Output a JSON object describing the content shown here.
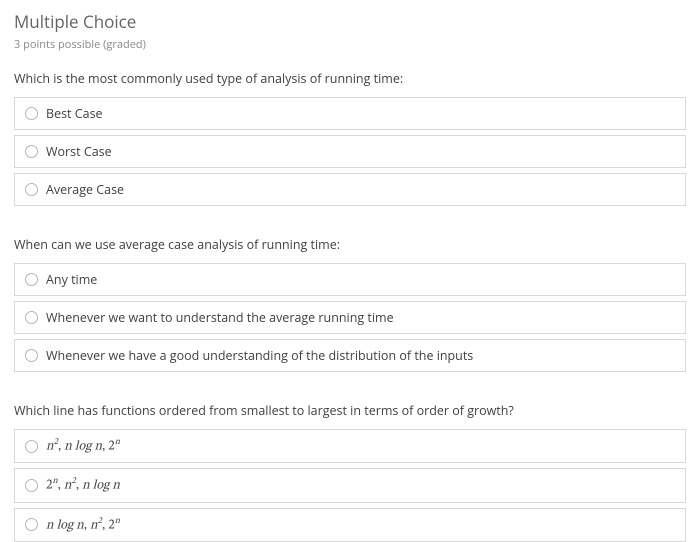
{
  "header": {
    "title": "Multiple Choice",
    "subtitle": "3 points possible (graded)"
  },
  "questions": [
    {
      "prompt": "Which is the most commonly used type of analysis of running time:",
      "options": [
        {
          "label": "Best Case"
        },
        {
          "label": "Worst Case"
        },
        {
          "label": "Average Case"
        }
      ]
    },
    {
      "prompt": "When can we use average case analysis of running time:",
      "options": [
        {
          "label": "Any time"
        },
        {
          "label": "Whenever we want to understand the average running time"
        },
        {
          "label": "Whenever we have a good understanding of the distribution of the inputs"
        }
      ]
    },
    {
      "prompt": "Which line has functions ordered from smallest to largest in terms of order of growth?",
      "options": [
        {
          "label_math": "n^2, n log n, 2^n"
        },
        {
          "label_math": "2^n, n^2, n log n"
        },
        {
          "label_math": "n log n, n^2, 2^n"
        }
      ]
    }
  ]
}
